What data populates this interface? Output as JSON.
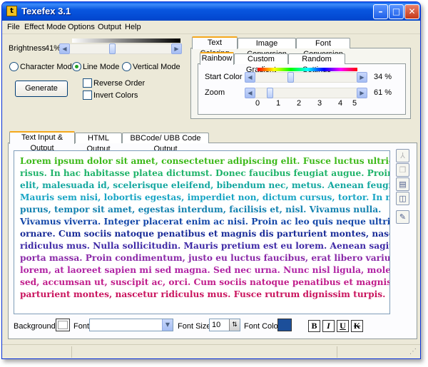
{
  "window": {
    "title": "Texefex 3.1"
  },
  "menu": [
    "File",
    "Effect Mode",
    "Options",
    "Output",
    "Help"
  ],
  "brightness": {
    "label": "Brightness",
    "value": "41%",
    "level": 41
  },
  "modes": {
    "character": "Character Mode",
    "line": "Line Mode",
    "vertical": "Vertical Mode",
    "selected": "line"
  },
  "generate_label": "Generate",
  "options": {
    "reverse": "Reverse Order",
    "invert": "Invert Colors"
  },
  "coloring_tabs": [
    "Text Coloring",
    "Image Conversion",
    "Font Conversion"
  ],
  "sub_tabs": [
    "Rainbow",
    "Custom Gradient",
    "Random Settings"
  ],
  "start_color": {
    "label": "Start Color",
    "value": "34 %",
    "level": 34
  },
  "zoom": {
    "label": "Zoom",
    "value": "61 %",
    "ticks": [
      "0",
      "1",
      "2",
      "3",
      "4",
      "5"
    ],
    "level": 61
  },
  "output_tabs": [
    "Text Input & Output",
    "HTML Output",
    "BBCode/ UBB Code Output"
  ],
  "lines": [
    {
      "text": "Lorem ipsum dolor sit amet, consectetuer adipiscing elit. Fusce luctus ultrices",
      "color": "#3db91a"
    },
    {
      "text": "risus. In hac habitasse platea dictumst. Donec faucibus feugiat augue. Proin leo",
      "color": "#1fb36a"
    },
    {
      "text": "elit, malesuada id, scelerisque eleifend, bibendum nec, metus. Aenean feugiat.",
      "color": "#14a7a0"
    },
    {
      "text": "Mauris sem nisi, lobortis egestas, imperdiet non, dictum cursus, tortor. In nunc",
      "color": "#1aa5c4"
    },
    {
      "text": "purus, tempor sit amet, egestas interdum, facilisis et, nisl. Vivamus nulla.",
      "color": "#1482b0"
    },
    {
      "text": "Vivamus viverra. Integer placerat enim ac nisi. Proin ac leo quis neque ultrices",
      "color": "#1447a8"
    },
    {
      "text": "ornare. Cum sociis natoque penatibus et magnis dis parturient montes, nascetur",
      "color": "#1a2c98"
    },
    {
      "text": "ridiculus mus. Nulla sollicitudin. Mauris pretium est eu lorem. Aenean sagittis",
      "color": "#3f2aa6"
    },
    {
      "text": "porta massa. Proin condimentum, justo eu luctus faucibus, erat libero varius",
      "color": "#8a2aa8"
    },
    {
      "text": "lorem, at laoreet sapien mi sed magna. Sed nec urna. Nunc nisl ligula, molestie",
      "color": "#b024a4"
    },
    {
      "text": "sed, accumsan ut, suscipit ac, orci. Cum sociis natoque penatibus et magnis dis",
      "color": "#c01c8a"
    },
    {
      "text": "parturient montes, nascetur ridiculus mus. Fusce rutrum dignissim turpis.",
      "color": "#c9145e"
    }
  ],
  "bottom": {
    "background_label": "Background",
    "font_label": "Font",
    "font_value": "",
    "font_size_label": "Font Size",
    "font_size_value": "10",
    "font_color_label": "Font Color",
    "font_color": "#1c4f9a",
    "bold": "B",
    "italic": "I",
    "underline": "U",
    "strike": "K"
  }
}
